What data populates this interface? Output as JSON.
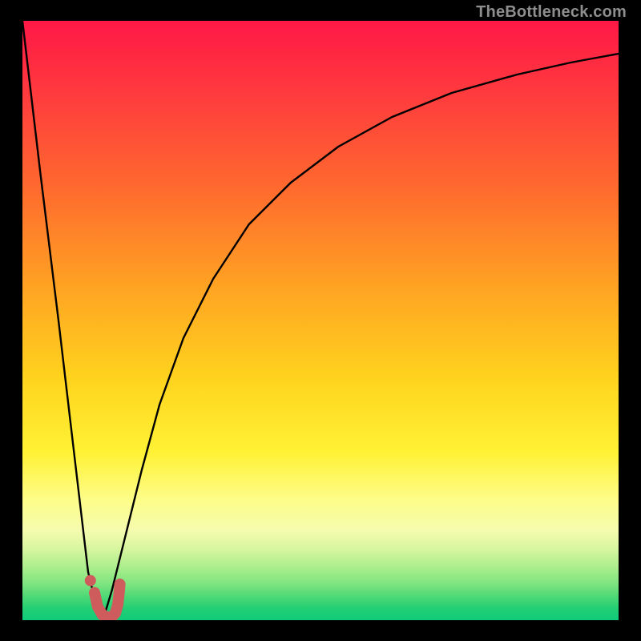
{
  "watermark": "TheBottleneck.com",
  "chart_data": {
    "type": "line",
    "title": "",
    "xlabel": "",
    "ylabel": "",
    "xlim": [
      0,
      100
    ],
    "ylim": [
      0,
      100
    ],
    "grid": false,
    "legend": false,
    "series": [
      {
        "name": "left-branch",
        "x": [
          0,
          3,
          6,
          9,
          11,
          12.5,
          13.5
        ],
        "y": [
          100,
          75,
          50,
          25,
          8,
          2,
          0
        ]
      },
      {
        "name": "right-branch",
        "x": [
          13.5,
          15,
          17,
          20,
          23,
          27,
          32,
          38,
          45,
          53,
          62,
          72,
          83,
          92,
          100
        ],
        "y": [
          0,
          5,
          13,
          25,
          36,
          47,
          57,
          66,
          73,
          79,
          84,
          88,
          91,
          93,
          94.5
        ]
      }
    ],
    "marker_series": {
      "name": "bottom-j-marker",
      "color": "#cf5c5c",
      "x": [
        12.1,
        12.6,
        13.4,
        14.2,
        15.0,
        15.6,
        16.0,
        16.2,
        16.35
      ],
      "y": [
        4.6,
        2.3,
        0.9,
        0.5,
        0.55,
        1.2,
        2.6,
        4.3,
        6.0
      ]
    },
    "marker_dot": {
      "x": 11.4,
      "y": 6.6,
      "color": "#cf5c5c"
    }
  }
}
